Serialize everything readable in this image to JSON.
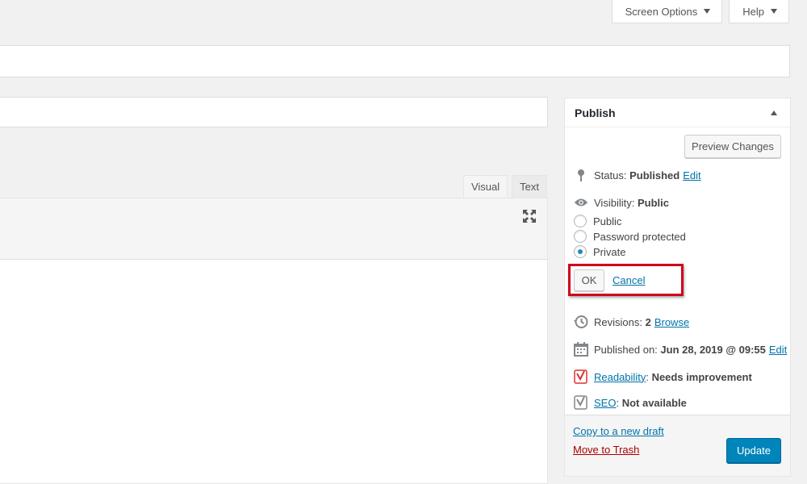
{
  "screen_meta": {
    "screen_options_label": "Screen Options",
    "help_label": "Help"
  },
  "editor": {
    "tabs": [
      {
        "label": "Visual",
        "active": true
      },
      {
        "label": "Text",
        "active": false
      }
    ]
  },
  "publish": {
    "title": "Publish",
    "preview_label": "Preview Changes",
    "status_label": "Status:",
    "status_value": "Published",
    "status_edit": "Edit",
    "visibility_label": "Visibility:",
    "visibility_value": "Public",
    "visibility_options": [
      {
        "label": "Public",
        "checked": false
      },
      {
        "label": "Password protected",
        "checked": false
      },
      {
        "label": "Private",
        "checked": true
      }
    ],
    "ok_label": "OK",
    "cancel_label": "Cancel",
    "revisions_label": "Revisions:",
    "revisions_value": "2",
    "revisions_browse": "Browse",
    "published_on_label": "Published on:",
    "published_on_value": "Jun 28, 2019 @ 09:55",
    "published_on_edit": "Edit",
    "readability_label": "Readability",
    "readability_value": "Needs improvement",
    "seo_label": "SEO",
    "seo_value": "Not available",
    "copy_draft_label": "Copy to a new draft",
    "trash_label": "Move to Trash",
    "update_label": "Update"
  },
  "colors": {
    "accent": "#0073aa",
    "primary_button": "#0085ba",
    "highlight_border": "#d0021b",
    "trash": "#a00000",
    "readability_icon": "#dc3232"
  }
}
